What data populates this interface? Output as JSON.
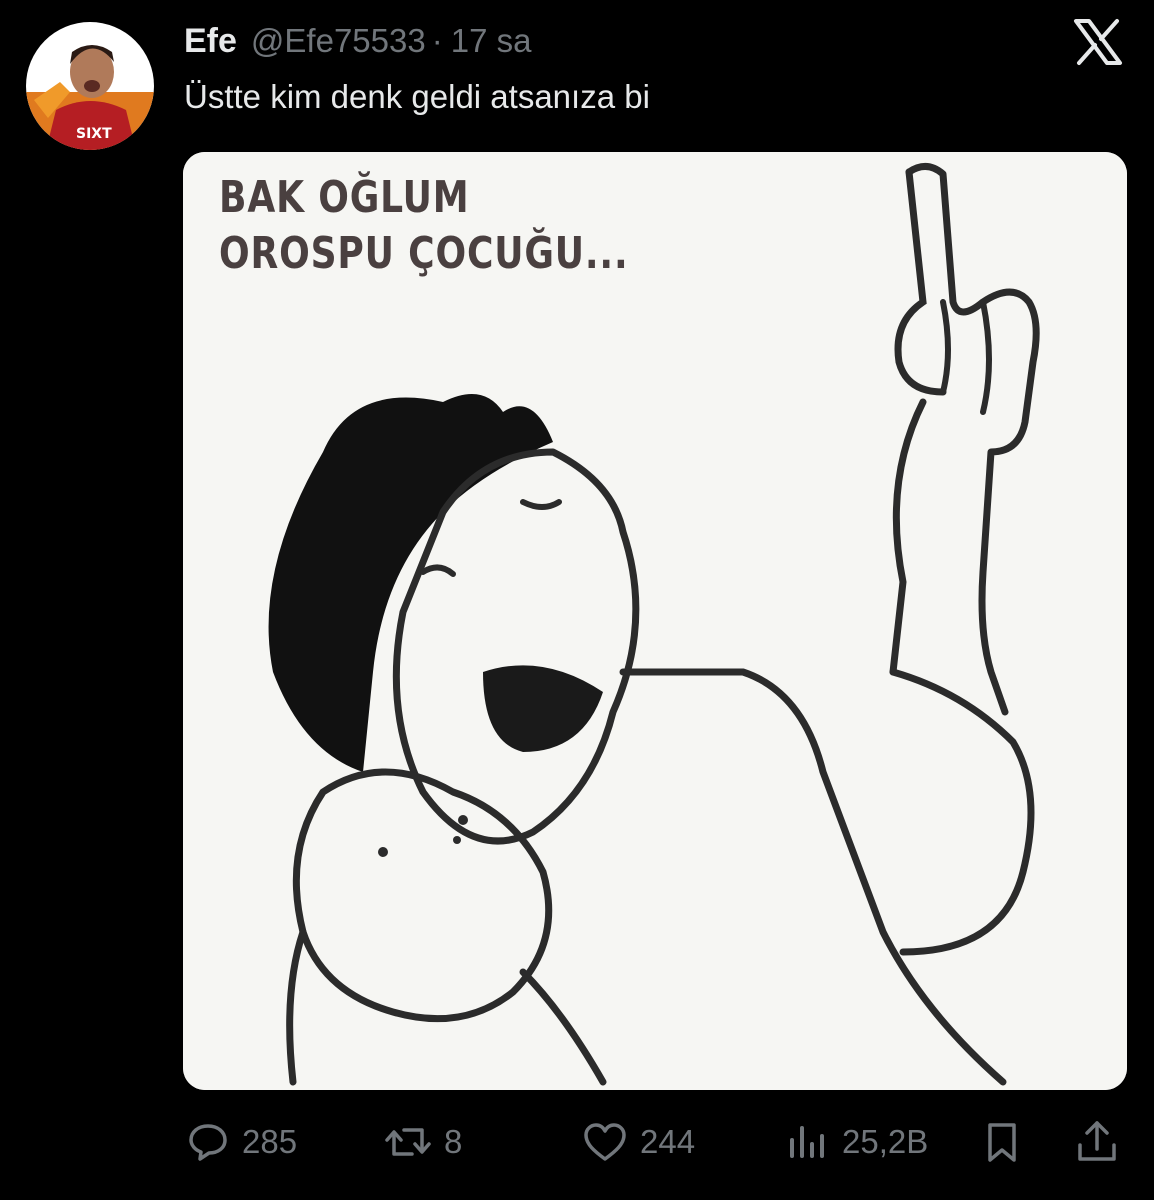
{
  "tweet": {
    "display_name": "Efe",
    "handle": "@Efe75533",
    "separator": "·",
    "time": "17 sa",
    "text": "Üstte kim denk geldi atsanıza bi",
    "avatar_icon": "user-avatar",
    "platform_icon": "x-logo-icon"
  },
  "media": {
    "caption_line1": "BAK OĞLUM",
    "caption_line2": "OROSPU ÇOCUĞU..."
  },
  "actions": {
    "replies": "285",
    "reposts": "8",
    "likes": "244",
    "views": "25,2B",
    "reply_icon": "reply-icon",
    "repost_icon": "repost-icon",
    "like_icon": "heart-icon",
    "views_icon": "views-icon",
    "bookmark_icon": "bookmark-icon",
    "share_icon": "share-icon"
  },
  "colors": {
    "background": "#000000",
    "primary_text": "#e7e9ea",
    "secondary_text": "#71767b"
  }
}
